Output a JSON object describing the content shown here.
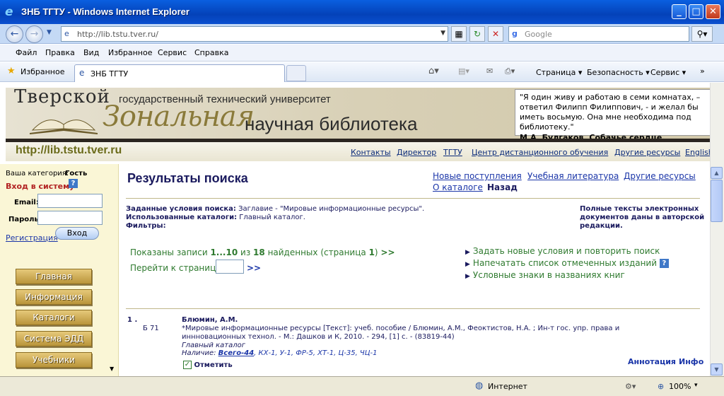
{
  "window": {
    "title": "ЗНБ ТГТУ - Windows Internet Explorer"
  },
  "address": {
    "url": "http://lib.tstu.tver.ru/",
    "search_placeholder": "Google"
  },
  "menu": [
    "Файл",
    "Правка",
    "Вид",
    "Избранное",
    "Сервис",
    "Справка"
  ],
  "favbar": {
    "favorites_label": "Избранное",
    "tab_title": "ЗНБ ТГТУ",
    "page_label": "Страница",
    "safety_label": "Безопасность",
    "tools_label": "Сервис"
  },
  "banner": {
    "line1": "Тверской",
    "line1b": "государственный технический университет",
    "line2": "Зональная",
    "line2b": "научная библиотека",
    "quote": "\"Я один живу и работаю в семи комнатах, – ответил Филипп Филиппович, - и желал бы иметь восьмую. Она мне необходима под библиотеку.\"",
    "quote_author": "М.А. Булгаков. Собачье сердце."
  },
  "sitebar": {
    "url": "http://lib.tstu.tver.ru",
    "links": [
      "Контакты",
      "Директор",
      "ТГТУ",
      "Центр дистанционного обучения",
      "Другие ресурсы",
      "English"
    ]
  },
  "left": {
    "category_label": "Ваша категория:",
    "category_value": "Гость",
    "login_title": "Вход в систему",
    "help": "?",
    "email_label": "Email:",
    "password_label": "Пароль:",
    "register": "Регистрация",
    "login_button": "Вход",
    "menu": [
      "Главная",
      "Информация",
      "Каталоги",
      "Система ЭДД",
      "Учебники"
    ]
  },
  "main": {
    "title": "Результаты поиска",
    "toplinks": [
      "Новые поступления",
      "Учебная литература",
      "Другие ресурсы",
      "О каталоге",
      "Назад"
    ],
    "cond_label1": "Заданные условия поиска:",
    "cond_value1": "Заглавие - \"Мировые информационные ресурсы\".",
    "cond_label2": "Использованные каталоги:",
    "cond_value2": "Главный каталог.",
    "cond_label3": "Фильтры:",
    "fulltext_note": "Полные тексты электронных документов даны в авторской редакции.",
    "shown_prefix": "Показаны записи",
    "shown_range": "1...10",
    "shown_of": "из",
    "shown_total": "18",
    "shown_suffix": "найденных (страница",
    "shown_page": "1",
    "shown_close": ")",
    "shown_arrows": ">>",
    "goto_label": "Перейти к странице",
    "goto_arrows": ">>",
    "actions": [
      "Задать новые условия и повторить поиск",
      "Напечатать список отмеченных изданий",
      "Условные знаки в названиях книг"
    ],
    "record": {
      "num": "1 .",
      "code": "Б 71",
      "author": "Блюмин, А.М.",
      "desc_line1": "*Мировые информационные ресурсы [Текст]: учеб. пособие / Блюмин, А.М., Феоктистов, Н.А. ; Ин-т гос. упр. права и",
      "desc_line2": "иннновационных технол. - М.: Дашков и К, 2010. - 294, [1] с. - (83819-44)",
      "catalog": "Главный каталог",
      "avail_label": "Наличие:",
      "avail_total": "Всего-44",
      "avail_rest": ", КХ-1, У-1, ФР-5, ХТ-1, Ц-35, ЧЦ-1",
      "check_label": "Отметить",
      "annot": "Аннотация",
      "info": "Инфо"
    }
  },
  "status": {
    "zone": "Интернет",
    "zoom": "100%"
  }
}
